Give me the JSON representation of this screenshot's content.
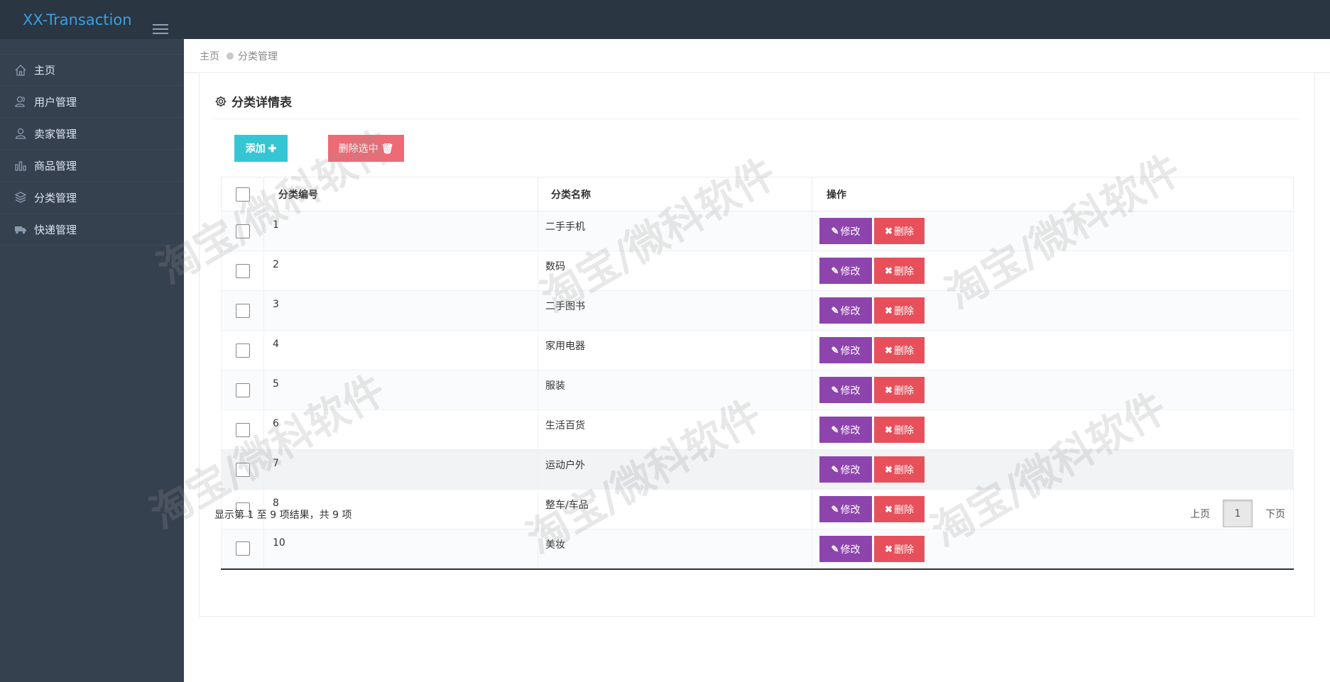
{
  "app": {
    "title": "XX-Transaction"
  },
  "sidebar": {
    "items": [
      {
        "label": "主页",
        "icon": "home-icon"
      },
      {
        "label": "用户管理",
        "icon": "users-icon"
      },
      {
        "label": "卖家管理",
        "icon": "user-icon"
      },
      {
        "label": "商品管理",
        "icon": "bar-chart-icon"
      },
      {
        "label": "分类管理",
        "icon": "layers-icon"
      },
      {
        "label": "快递管理",
        "icon": "truck-icon"
      }
    ]
  },
  "breadcrumb": {
    "home": "主页",
    "current": "分类管理"
  },
  "panel": {
    "title": "分类详情表",
    "add_label": "添加",
    "add_icon": "✚",
    "delete_selected_label": "删除选中",
    "delete_selected_icon": "🗑"
  },
  "table": {
    "headers": {
      "id": "分类编号",
      "name": "分类名称",
      "ops": "操作"
    },
    "edit_label": "修改",
    "delete_label": "删除",
    "rows": [
      {
        "id": "1",
        "name": "二手手机"
      },
      {
        "id": "2",
        "name": "数码"
      },
      {
        "id": "3",
        "name": "二手图书"
      },
      {
        "id": "4",
        "name": "家用电器"
      },
      {
        "id": "5",
        "name": "服装"
      },
      {
        "id": "6",
        "name": "生活百货"
      },
      {
        "id": "7",
        "name": "运动户外"
      },
      {
        "id": "8",
        "name": "整车/车品"
      },
      {
        "id": "10",
        "name": "美妆"
      }
    ]
  },
  "pagination": {
    "info": "显示第 1 至 9 项结果，共 9 项",
    "prev": "上页",
    "current": "1",
    "next": "下页"
  },
  "watermark": "淘宝/微科软件",
  "colors": {
    "topbar": "#2b3643",
    "sidebar": "#364150",
    "brand": "#3a9fe0",
    "add_button": "#36c6d3",
    "delete_selected_button": "#ed6b75",
    "edit_button": "#8e44ad",
    "delete_button": "#e7505a"
  }
}
